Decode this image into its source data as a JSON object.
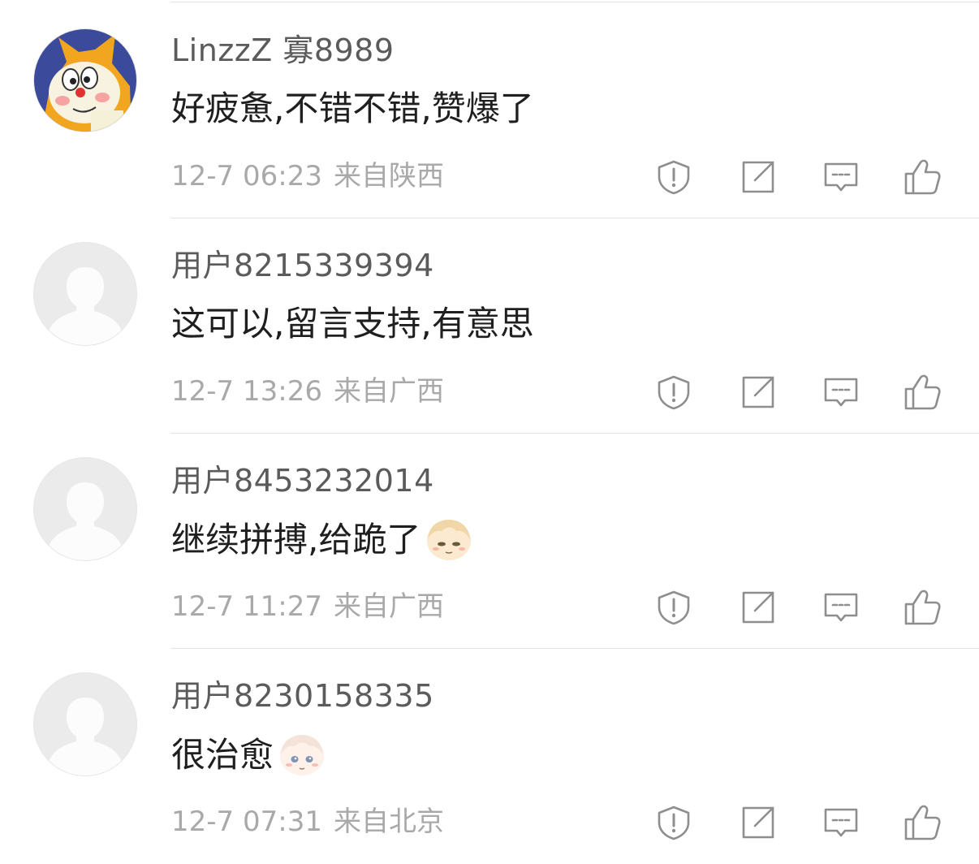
{
  "comments": [
    {
      "username": "LinzzZ 寡8989",
      "text": "好疲惫,不错不错,赞爆了",
      "date": "12-7 06:23",
      "location": "来自陕西",
      "avatar": "cartoon-cat-avatar",
      "emoji": null
    },
    {
      "username": "用户8215339394",
      "text": "这可以,留言支持,有意思",
      "date": "12-7 13:26",
      "location": "来自广西",
      "avatar": "default-avatar",
      "emoji": null
    },
    {
      "username": "用户8453232014",
      "text": "继续拼搏,给跪了",
      "date": "12-7 11:27",
      "location": "来自广西",
      "avatar": "default-avatar",
      "emoji": "anime-face-emoji"
    },
    {
      "username": "用户8230158335",
      "text": "很治愈",
      "date": "12-7 07:31",
      "location": "来自北京",
      "avatar": "default-avatar",
      "emoji": "anime-face-emoji"
    }
  ],
  "actions": [
    "report-icon",
    "share-icon",
    "reply-icon",
    "like-icon"
  ],
  "colors": {
    "username": "#5b5b5b",
    "text": "#1f1f1f",
    "meta": "#a9a9a9",
    "icon": "#8e8e8e",
    "divider": "#e3e3e3",
    "avatar_placeholder": "#ebebeb"
  }
}
